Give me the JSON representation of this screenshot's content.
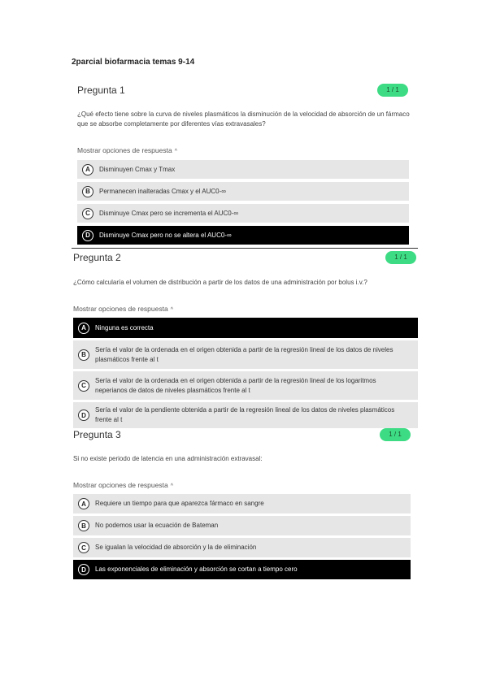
{
  "document": {
    "title": "2parcial biofarmacia temas 9-14"
  },
  "q1": {
    "title": "Pregunta 1",
    "score": "1 / 1",
    "text": "¿Qué efecto tiene sobre la curva de niveles plasmáticos la disminución de la velocidad de absorción de un fármaco que se absorbe completamente por diferentes vías extravasales?",
    "show_options": "Mostrar opciones de respuesta",
    "options": [
      {
        "letter": "A",
        "text": "Disminuyen Cmax y Tmax"
      },
      {
        "letter": "B",
        "text": "Permanecen inalteradas Cmax y el AUC0-∞"
      },
      {
        "letter": "C",
        "text": "Disminuye Cmax pero se incrementa el AUC0-∞"
      },
      {
        "letter": "D",
        "text": "Disminuye Cmax pero no se altera el AUC0-∞"
      }
    ]
  },
  "q2": {
    "title": "Pregunta 2",
    "score": "1 / 1",
    "text": "¿Cómo calcularía el volumen de distribución a partir de los datos de una administración por bolus i.v.?",
    "show_options": "Mostrar opciones de respuesta",
    "options": [
      {
        "letter": "A",
        "text": "Ninguna es correcta"
      },
      {
        "letter": "B",
        "text": "Sería el valor de la ordenada en el origen obtenida a partir de la regresión lineal de los datos de niveles plasmáticos frente al t"
      },
      {
        "letter": "C",
        "text": "Sería el valor de la ordenada en el origen obtenida a partir de la regresión lineal de los logaritmos neperianos de datos de niveles plasmáticos frente al t"
      },
      {
        "letter": "D",
        "text": "Sería el valor de la pendiente obtenida a partir de la regresión lineal de los datos de niveles plasmáticos frente al t"
      }
    ]
  },
  "q3": {
    "title": "Pregunta 3",
    "score": "1 / 1",
    "text": "Si no existe periodo de latencia en una administración extravasal:",
    "show_options": "Mostrar opciones de respuesta",
    "options": [
      {
        "letter": "A",
        "text": "Requiere un tiempo para que aparezca fármaco en sangre"
      },
      {
        "letter": "B",
        "text": "No podemos usar la ecuación de Bateman"
      },
      {
        "letter": "C",
        "text": "Se igualan la velocidad de absorción y la de eliminación"
      },
      {
        "letter": "D",
        "text": "Las exponenciales de eliminación y absorción se cortan a tiempo cero"
      }
    ]
  },
  "colors": {
    "badge": "#3ddc84",
    "option_bg": "#e6e6e6",
    "selected_bg": "#000000"
  },
  "icons": {
    "caret": "chevron-up-icon"
  }
}
